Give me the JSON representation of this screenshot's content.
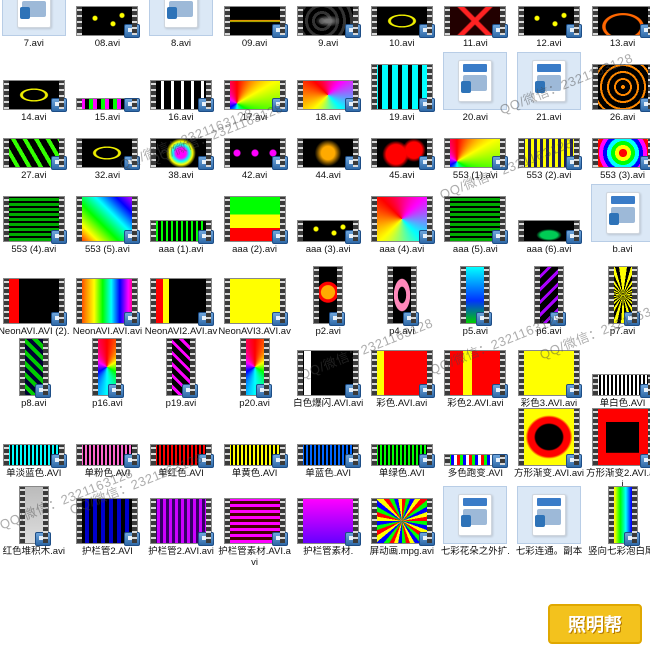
{
  "files": [
    {
      "label": "7.avi",
      "kind": "file"
    },
    {
      "label": "08.avi",
      "kind": "video",
      "style": "dots-yellow"
    },
    {
      "label": "8.avi",
      "kind": "file"
    },
    {
      "label": "09.avi",
      "kind": "video",
      "style": "streak-orange"
    },
    {
      "label": "9.avi",
      "kind": "video",
      "style": "swirl-grey"
    },
    {
      "label": "10.avi",
      "kind": "video",
      "style": "ring-yellow"
    },
    {
      "label": "11.avi",
      "kind": "video",
      "style": "x-red"
    },
    {
      "label": "12.avi",
      "kind": "video",
      "style": "dots-yellow"
    },
    {
      "label": "13.avi",
      "kind": "video",
      "style": "arc-orange"
    },
    {
      "label": "14.avi",
      "kind": "video",
      "style": "ring-yellow",
      "size": "wide"
    },
    {
      "label": "15.avi",
      "kind": "video",
      "style": "strip-dots",
      "size": "strip"
    },
    {
      "label": "16.avi",
      "kind": "video",
      "style": "bars-white"
    },
    {
      "label": "17.avi",
      "kind": "video",
      "style": "radial-rainbow"
    },
    {
      "label": "18.avi",
      "kind": "video",
      "style": "diamond-rainbow"
    },
    {
      "label": "19.avi",
      "kind": "video",
      "style": "grid-color",
      "size": "tall"
    },
    {
      "label": "20.avi",
      "kind": "file"
    },
    {
      "label": "21.avi",
      "kind": "file"
    },
    {
      "label": "26.avi",
      "kind": "video",
      "style": "web-orange",
      "size": "tall"
    },
    {
      "label": "27.avi",
      "kind": "video",
      "style": "bars-green"
    },
    {
      "label": "32.avi",
      "kind": "video",
      "style": "ring-yellow"
    },
    {
      "label": "38.avi",
      "kind": "video",
      "style": "rainbow-blob"
    },
    {
      "label": "42.avi",
      "kind": "video",
      "style": "dots-magenta"
    },
    {
      "label": "44.avi",
      "kind": "video",
      "style": "number"
    },
    {
      "label": "45.avi",
      "kind": "video",
      "style": "red-blob"
    },
    {
      "label": "553 (1).avi",
      "kind": "video",
      "style": "radial-rainbow"
    },
    {
      "label": "553 (2).avi",
      "kind": "video",
      "style": "blue-yellow"
    },
    {
      "label": "553 (3).avi",
      "kind": "video",
      "style": "target-rainbow"
    },
    {
      "label": "553 (4).avi",
      "kind": "video",
      "style": "green-grid",
      "size": "tall"
    },
    {
      "label": "553 (5).avi",
      "kind": "video",
      "style": "x-rainbow",
      "size": "tall"
    },
    {
      "label": "aaa (1).avi",
      "kind": "video",
      "style": "dots-green",
      "size": "short"
    },
    {
      "label": "aaa (2).avi",
      "kind": "video",
      "style": "eq-bars",
      "size": "tall"
    },
    {
      "label": "aaa (3).avi",
      "kind": "video",
      "style": "dots-yellow",
      "size": "short"
    },
    {
      "label": "aaa (4).avi",
      "kind": "video",
      "style": "diamond-rainbow",
      "size": "tall"
    },
    {
      "label": "aaa (5).avi",
      "kind": "video",
      "style": "green-grid",
      "size": "tall"
    },
    {
      "label": "aaa (6).avi",
      "kind": "video",
      "style": "car",
      "size": "short"
    },
    {
      "label": "b.avi",
      "kind": "file"
    },
    {
      "label": "NeonAVI.AVI (2).avi",
      "kind": "video",
      "style": "neon-red-band",
      "size": "tall"
    },
    {
      "label": "NeonAVI.AVI.avi",
      "kind": "video",
      "style": "neon-rainbow",
      "size": "tall"
    },
    {
      "label": "NeonAVI2.AVI.avi",
      "kind": "video",
      "style": "neon-red-black",
      "size": "tall"
    },
    {
      "label": "NeonAVI3.AVI.avi",
      "kind": "video",
      "style": "yellow",
      "size": "tall"
    },
    {
      "label": "p2.avi",
      "kind": "video",
      "style": "heart",
      "size": "portrait"
    },
    {
      "label": "p4.avi",
      "kind": "video",
      "style": "pink-pattern",
      "size": "portrait"
    },
    {
      "label": "p5.avi",
      "kind": "video",
      "style": "blue-green",
      "size": "portrait"
    },
    {
      "label": "p6.avi",
      "kind": "video",
      "style": "purple-lines",
      "size": "portrait"
    },
    {
      "label": "p7.avi",
      "kind": "video",
      "style": "yellow-burst",
      "size": "portrait"
    },
    {
      "label": "p8.avi",
      "kind": "video",
      "style": "green-tiles",
      "size": "portrait"
    },
    {
      "label": "p16.avi",
      "kind": "video",
      "style": "color-burst",
      "size": "portrait"
    },
    {
      "label": "p19.avi",
      "kind": "video",
      "style": "chevrons",
      "size": "portrait"
    },
    {
      "label": "p20.avi",
      "kind": "video",
      "style": "rainbow-cone",
      "size": "portrait"
    },
    {
      "label": "白色爆闪.AVI.avi",
      "kind": "video",
      "style": "white-flash",
      "size": "tall"
    },
    {
      "label": "彩色.AVI.avi",
      "kind": "video",
      "style": "red-yellow",
      "size": "tall"
    },
    {
      "label": "彩色2.AVI.avi",
      "kind": "video",
      "style": "red-yellow2",
      "size": "tall"
    },
    {
      "label": "彩色3.AVI.avi",
      "kind": "video",
      "style": "yellow",
      "size": "tall"
    },
    {
      "label": "单白色.AVI",
      "kind": "video",
      "style": "white-stripes",
      "size": "short"
    },
    {
      "label": "单淡蓝色.AVI",
      "kind": "video",
      "style": "cyan-stripes",
      "size": "short"
    },
    {
      "label": "单粉色.AVI",
      "kind": "video",
      "style": "pink-stripes",
      "size": "short"
    },
    {
      "label": "单红色.AVI",
      "kind": "video",
      "style": "red-stripes",
      "size": "short"
    },
    {
      "label": "单黄色.AVI",
      "kind": "video",
      "style": "yellow-stripes",
      "size": "short"
    },
    {
      "label": "单蓝色.AVI",
      "kind": "video",
      "style": "blue-stripes",
      "size": "short"
    },
    {
      "label": "单绿色.AVI",
      "kind": "video",
      "style": "green-stripes",
      "size": "short"
    },
    {
      "label": "多色跑变.AVI",
      "kind": "video",
      "style": "multi-dots",
      "size": "strip"
    },
    {
      "label": "方形渐变.AVI.avi",
      "kind": "video",
      "style": "square-red",
      "size": "big"
    },
    {
      "label": "方形渐变2.AVI.avi",
      "kind": "video",
      "style": "square-red2",
      "size": "big"
    },
    {
      "label": "红色堆积木.avi",
      "kind": "video",
      "style": "grey-tall",
      "size": "portrait"
    },
    {
      "label": "护栏管2.AVI",
      "kind": "video",
      "style": "blue-bars",
      "size": "tall"
    },
    {
      "label": "护栏管2.AVI.avi",
      "kind": "video",
      "style": "purple-bars",
      "size": "tall"
    },
    {
      "label": "护栏管素材.AVI.avi",
      "kind": "video",
      "style": "magenta-bars",
      "size": "tall"
    },
    {
      "label": "护栏管素材.",
      "kind": "video",
      "style": "magenta-grad",
      "size": "tall"
    },
    {
      "label": "屏动画.mpg.avi",
      "kind": "video",
      "style": "rainbow-rays",
      "size": "tall"
    },
    {
      "label": "七彩花朵之外扩.",
      "kind": "file"
    },
    {
      "label": "七彩连通。副本",
      "kind": "file"
    },
    {
      "label": "竖向七彩泡白尾.",
      "kind": "video",
      "style": "rainbow-vertical",
      "size": "portrait"
    }
  ],
  "watermark": "QQ/微信：2321163128",
  "logo_text": "照明帮",
  "colors": {
    "badge": "#2f6aa8",
    "file_header": "#3a7cc8"
  }
}
